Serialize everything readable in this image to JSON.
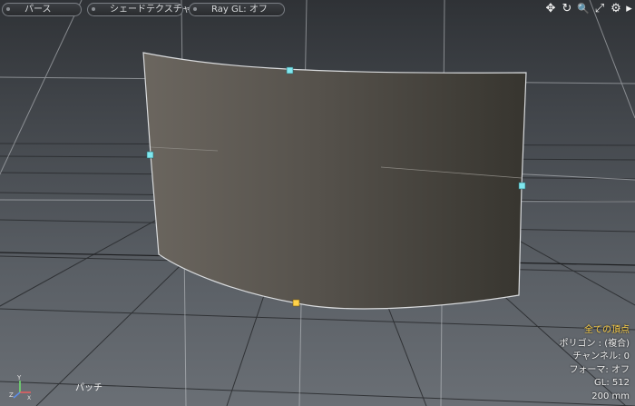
{
  "toolbar": {
    "view_mode": "パース",
    "shading_mode": "シェードテクスチャ",
    "ray_gl": "Ray GL: オフ"
  },
  "toolbar_icons": [
    {
      "name": "move-view-icon",
      "glyph": "✥"
    },
    {
      "name": "rotate-view-icon",
      "glyph": "↻"
    },
    {
      "name": "zoom-view-icon",
      "glyph": "🔍"
    },
    {
      "name": "maximize-view-icon",
      "glyph": "⤢"
    },
    {
      "name": "settings-icon",
      "glyph": "⚙"
    },
    {
      "name": "menu-arrow-icon",
      "glyph": "▸"
    }
  ],
  "info_overlay": {
    "selection": "全ての頂点",
    "polygon": "ポリゴン : (複合)",
    "channel": "チャンネル: 0",
    "former": "フォーマ: オフ",
    "gl": "GL: 512",
    "scale": "200 mm"
  },
  "mode_label": "パッチ",
  "axis_gizmo": {
    "y": "Y",
    "z": "Z",
    "x": "X"
  },
  "colors": {
    "surface_dark": "#3a3734",
    "surface_light": "#6a665f",
    "vertex_cyan": "#7fe8ef",
    "vertex_selected": "#ffd24a",
    "highlight_text": "#ffd24a"
  }
}
